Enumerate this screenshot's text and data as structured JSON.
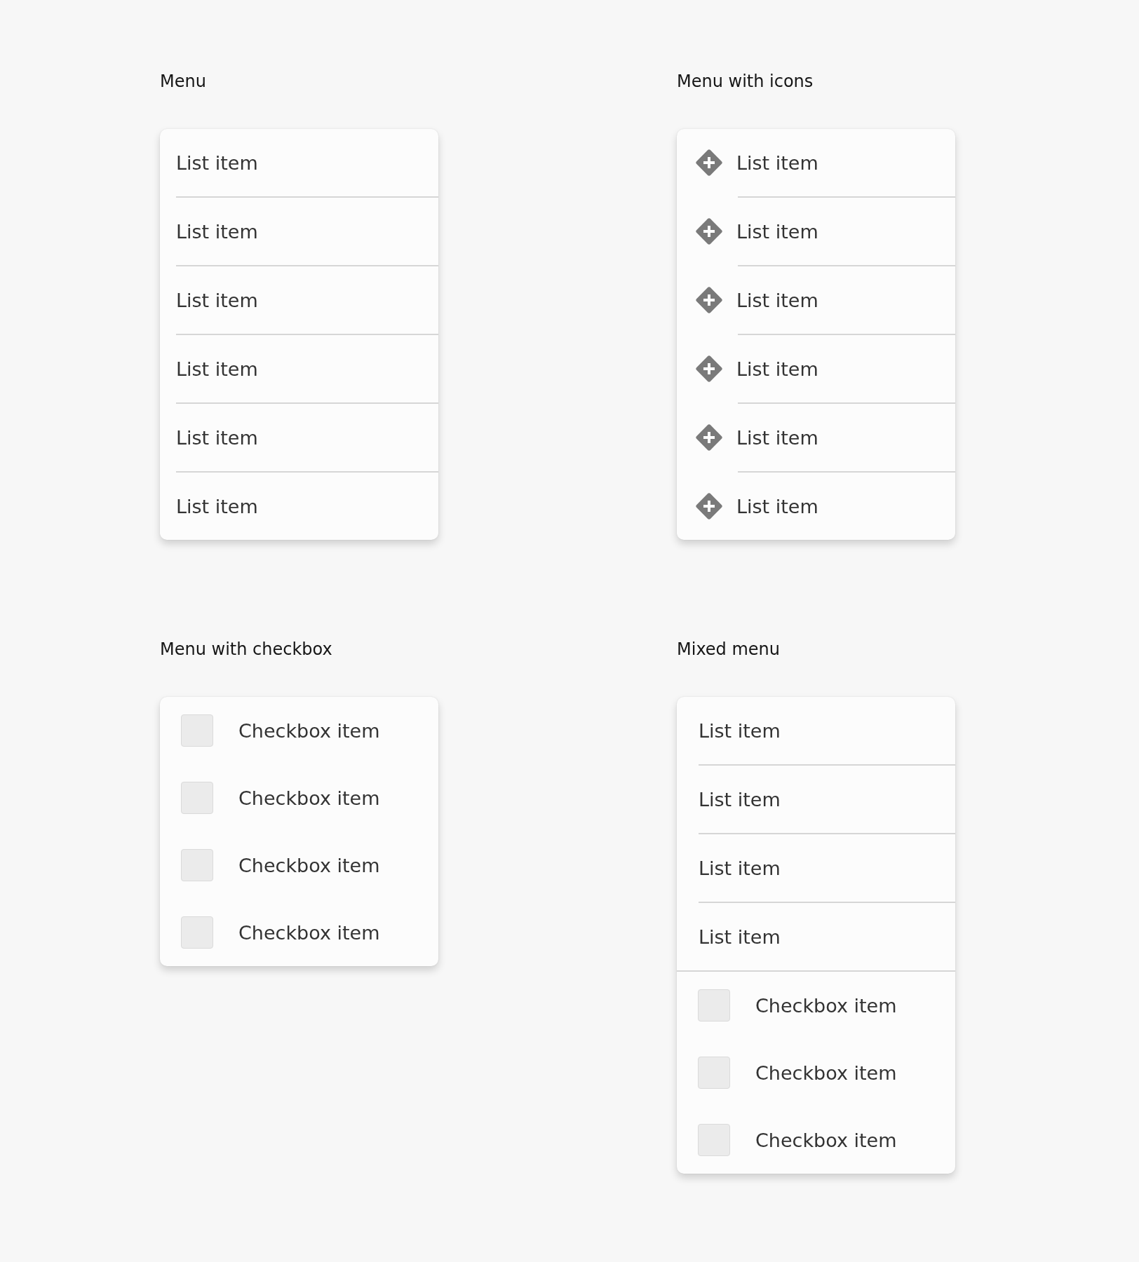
{
  "menus": [
    {
      "title": "Menu",
      "items": [
        {
          "kind": "plain",
          "label": "List item"
        },
        {
          "kind": "plain",
          "label": "List item"
        },
        {
          "kind": "plain",
          "label": "List item"
        },
        {
          "kind": "plain",
          "label": "List item"
        },
        {
          "kind": "plain",
          "label": "List item"
        },
        {
          "kind": "plain",
          "label": "List item"
        }
      ]
    },
    {
      "title": "Menu with icons",
      "items": [
        {
          "kind": "icon",
          "label": "List item"
        },
        {
          "kind": "icon",
          "label": "List item"
        },
        {
          "kind": "icon",
          "label": "List item"
        },
        {
          "kind": "icon",
          "label": "List item"
        },
        {
          "kind": "icon",
          "label": "List item"
        },
        {
          "kind": "icon",
          "label": "List item"
        }
      ]
    },
    {
      "title": "Menu with checkbox",
      "items": [
        {
          "kind": "checkbox",
          "label": "Checkbox item",
          "checked": false
        },
        {
          "kind": "checkbox",
          "label": "Checkbox item",
          "checked": false
        },
        {
          "kind": "checkbox",
          "label": "Checkbox item",
          "checked": false
        },
        {
          "kind": "checkbox",
          "label": "Checkbox item",
          "checked": false
        }
      ]
    },
    {
      "title": "Mixed menu",
      "items": [
        {
          "kind": "plain",
          "label": "List item"
        },
        {
          "kind": "plain",
          "label": "List item"
        },
        {
          "kind": "plain",
          "label": "List item"
        },
        {
          "kind": "plain",
          "label": "List item"
        },
        {
          "kind": "checkbox",
          "label": "Checkbox item",
          "checked": false
        },
        {
          "kind": "checkbox",
          "label": "Checkbox item",
          "checked": false
        },
        {
          "kind": "checkbox",
          "label": "Checkbox item",
          "checked": false
        }
      ]
    }
  ]
}
